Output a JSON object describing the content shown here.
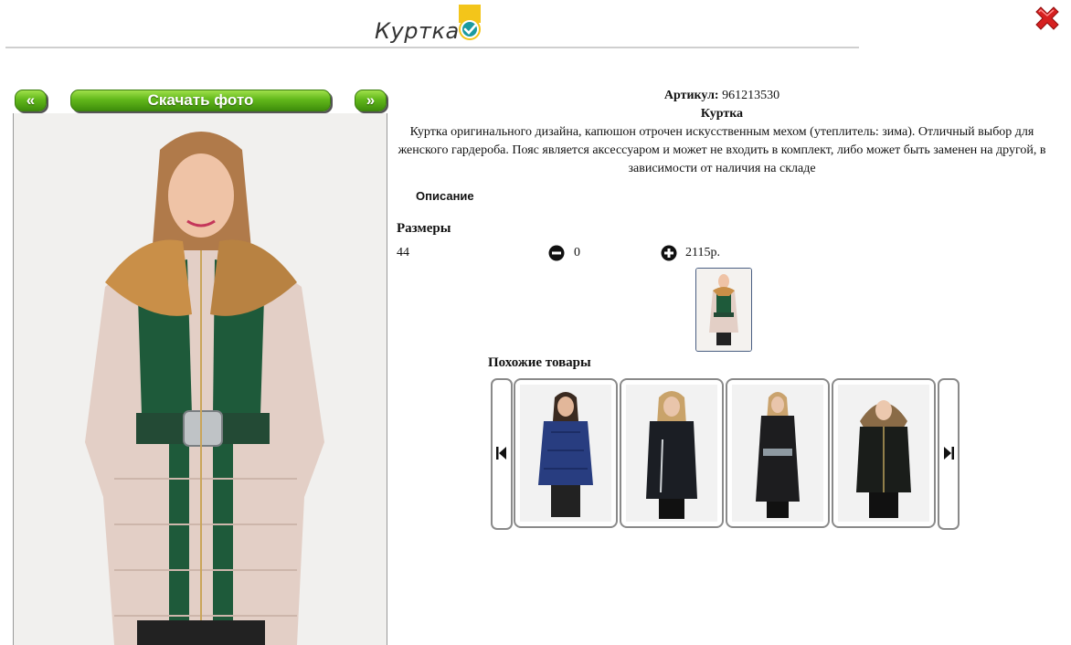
{
  "header": {
    "title": "Куртка",
    "verified_icon": "check-badge-icon",
    "close_icon": "red-x-icon"
  },
  "nav": {
    "prev_label": "«",
    "download_label": "Скачать фото",
    "next_label": "»"
  },
  "product": {
    "article_label": "Артикул:",
    "article_value": "961213530",
    "name": "Куртка",
    "description": "Куртка оригинального дизайна, капюшон отрочен искусственным мехом (утеплитель: зима). Отличный выбор для женского гардероба. Пояс является аксессуаром и может не входить в комплект, либо может быть заменен на другой, в зависимости от наличия на складе"
  },
  "tabs": {
    "description_label": "Описание"
  },
  "sizes": {
    "title": "Размеры",
    "rows": [
      {
        "size": "44",
        "qty": "0",
        "price": "2115р."
      }
    ]
  },
  "similar": {
    "title": "Похожие товары",
    "items": [
      {
        "name": "navy puffer jacket"
      },
      {
        "name": "black hooded jacket"
      },
      {
        "name": "black belted coat"
      },
      {
        "name": "black fur-hood jacket"
      }
    ]
  },
  "colors": {
    "button_green": "#62b81b",
    "close_red": "#d62020",
    "badge_yellow": "#f3c51a",
    "badge_teal": "#1a9aa0"
  }
}
